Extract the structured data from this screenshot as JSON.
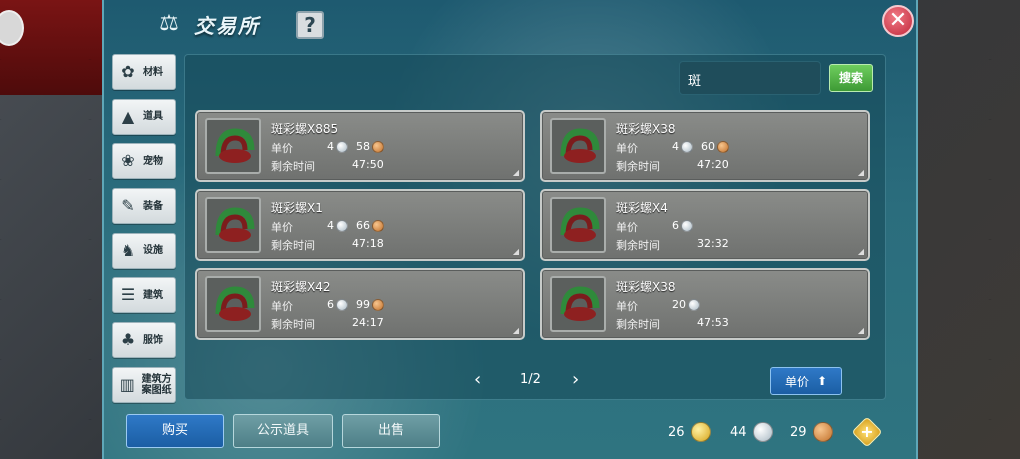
{
  "window": {
    "title": "交易所",
    "help_label": "?",
    "close_label": "✕"
  },
  "sidebar": {
    "items": [
      {
        "label": "材料",
        "icon": "materials-icon"
      },
      {
        "label": "道具",
        "icon": "props-icon"
      },
      {
        "label": "宠物",
        "icon": "pet-icon"
      },
      {
        "label": "装备",
        "icon": "equipment-icon"
      },
      {
        "label": "设施",
        "icon": "facility-icon"
      },
      {
        "label": "建筑",
        "icon": "building-icon"
      },
      {
        "label": "服饰",
        "icon": "clothing-icon"
      },
      {
        "label": "建筑方案图纸",
        "icon": "blueprint-icon"
      }
    ]
  },
  "search": {
    "value": "斑",
    "button_label": "搜索"
  },
  "listings": [
    {
      "name": "斑彩螺X885",
      "price_label": "单价",
      "silver": "4",
      "copper": "58",
      "time_label": "剩余时间",
      "time": "47:50"
    },
    {
      "name": "斑彩螺X38",
      "price_label": "单价",
      "silver": "4",
      "copper": "60",
      "time_label": "剩余时间",
      "time": "47:20"
    },
    {
      "name": "斑彩螺X1",
      "price_label": "单价",
      "silver": "4",
      "copper": "66",
      "time_label": "剩余时间",
      "time": "47:18"
    },
    {
      "name": "斑彩螺X4",
      "price_label": "单价",
      "silver": "6",
      "copper": "",
      "time_label": "剩余时间",
      "time": "32:32"
    },
    {
      "name": "斑彩螺X42",
      "price_label": "单价",
      "silver": "6",
      "copper": "99",
      "time_label": "剩余时间",
      "time": "24:17"
    },
    {
      "name": "斑彩螺X38",
      "price_label": "单价",
      "silver": "20",
      "copper": "",
      "time_label": "剩余时间",
      "time": "47:53"
    }
  ],
  "pagination": {
    "prev": "‹",
    "page": "1/2",
    "next": "›"
  },
  "sort": {
    "label": "单价"
  },
  "tabs": {
    "buy": "购买",
    "show": "公示道具",
    "sell": "出售"
  },
  "currency": {
    "gold": "26",
    "silver": "44",
    "copper": "29"
  },
  "add_label": "+",
  "colors": {
    "panel": "#2b6d7d",
    "card": "#7d7f7c",
    "buy_button": "#2f79c7",
    "search_button": "#4fae42"
  }
}
